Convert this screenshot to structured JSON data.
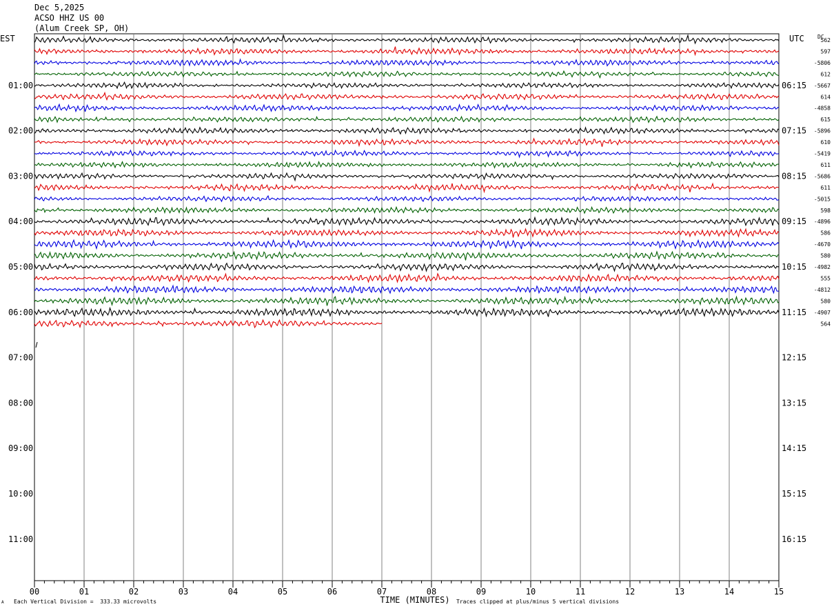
{
  "header": {
    "date": "Dec 5,2025",
    "station": "ACSO HHZ US 00",
    "location": "(Alum Creek SP, OH)"
  },
  "left_tz": "EST",
  "right_tz": "UTC",
  "dc_label": "DC",
  "footer": {
    "scale_note": "Each Vertical Division =  333.33 microvolts",
    "clip_note": "Traces clipped at plus/minus 5 vertical divisions",
    "corner_mark": "A"
  },
  "chart_data": {
    "type": "line",
    "title": "",
    "xlabel": "TIME (MINUTES)",
    "ylabel": "",
    "xlim": [
      0,
      15
    ],
    "x_ticks": [
      "00",
      "01",
      "02",
      "03",
      "04",
      "05",
      "06",
      "07",
      "08",
      "09",
      "10",
      "11",
      "12",
      "13",
      "14",
      "15"
    ],
    "left_hour_labels": [
      "01:00",
      "02:00",
      "03:00",
      "04:00",
      "05:00",
      "06:00",
      "07:00",
      "08:00",
      "09:00",
      "10:00",
      "11:00"
    ],
    "right_hour_labels": [
      "06:15",
      "07:15",
      "08:15",
      "09:15",
      "10:15",
      "11:15",
      "12:15",
      "13:15",
      "14:15",
      "15:15",
      "16:15"
    ],
    "trace_colors": [
      "#000000",
      "#e00000",
      "#0000e0",
      "#006000"
    ],
    "trace_count": 26,
    "last_trace_end_minute": 7.0,
    "dc_offsets": [
      "562",
      "597",
      "-5806",
      "612",
      "-5667",
      "614",
      "-4858",
      "615",
      "-5896",
      "610",
      "-5419",
      "611",
      "-5686",
      "611",
      "-5015",
      "598",
      "-4896",
      "586",
      "-4670",
      "580",
      "-4982",
      "555",
      "-4812",
      "580",
      "-4907",
      "564"
    ],
    "clip_divisions": 5,
    "microvolts_per_division": 333.33
  }
}
